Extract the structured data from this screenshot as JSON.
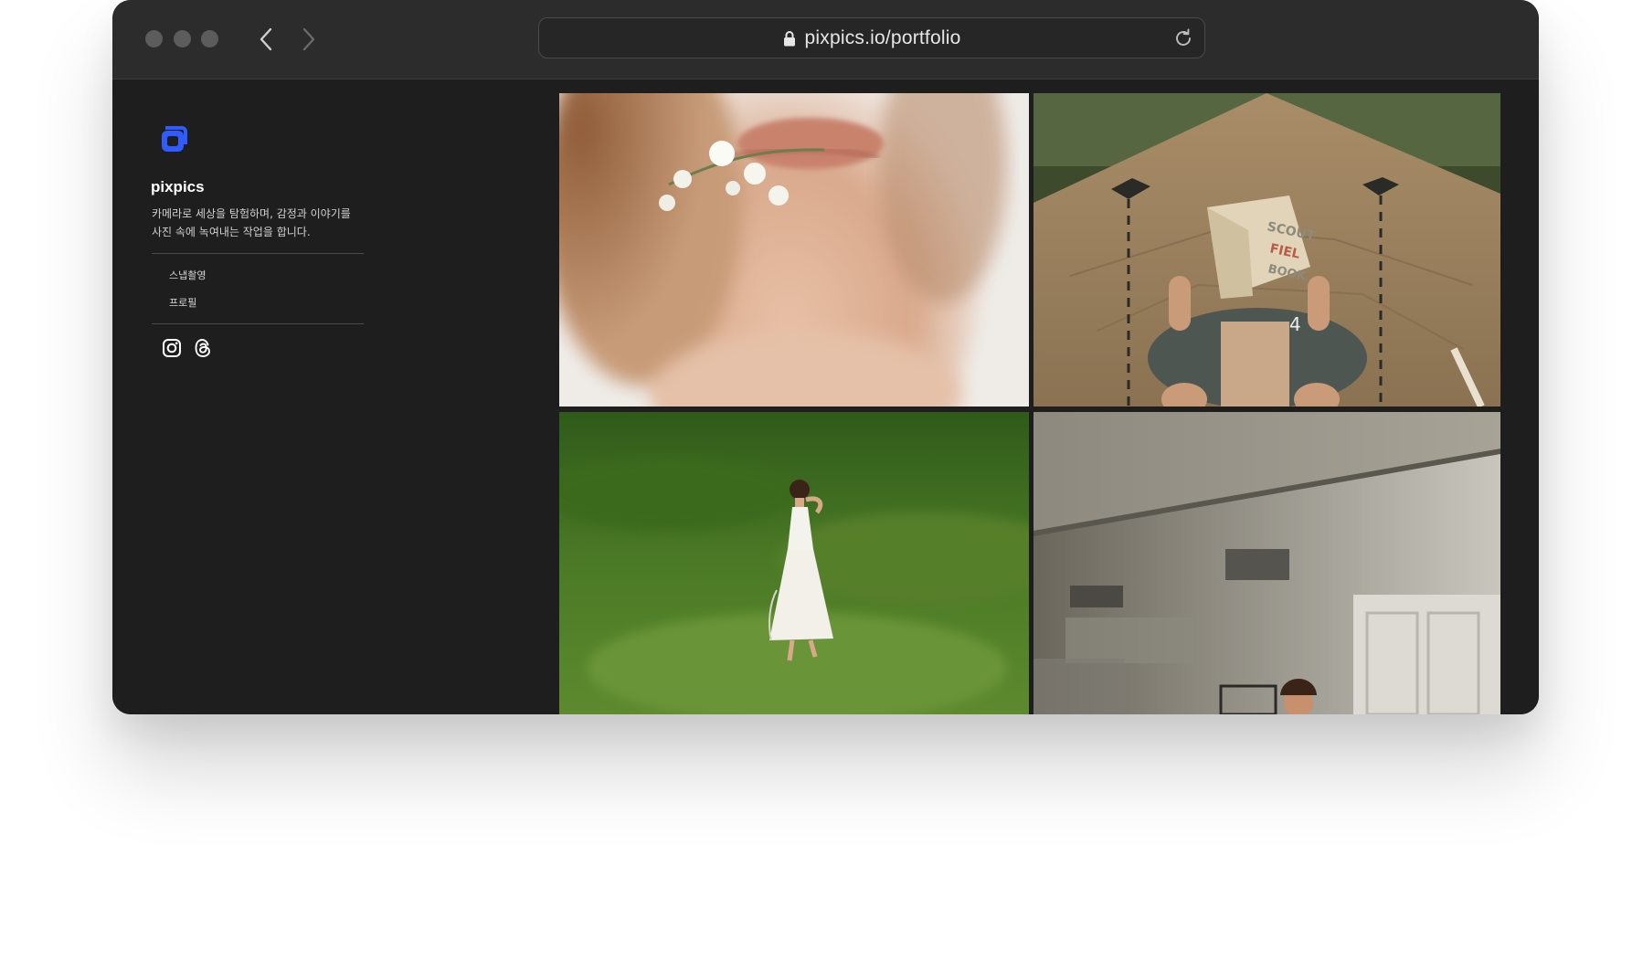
{
  "browser": {
    "url": "pixpics.io/portfolio",
    "icons": {
      "back": "chevron-left-icon",
      "forward": "chevron-right-icon",
      "lock": "lock-icon",
      "reload": "reload-icon"
    }
  },
  "sidebar": {
    "logo_icon": "pixpics-logo",
    "brand_name": "pixpics",
    "description": "카메라로 세상을 탐험하며, 감정과 이야기를 사진 속에 녹여내는 작업을 합니다.",
    "menu": [
      {
        "label": "스냅촬영"
      },
      {
        "label": "프로필"
      }
    ],
    "social": [
      {
        "icon": "instagram-icon"
      },
      {
        "icon": "threads-icon"
      }
    ]
  },
  "gallery": {
    "photos": [
      {
        "subject": "woman-with-white-flowers-closeup"
      },
      {
        "subject": "child-reading-scout-field-book-before-tent"
      },
      {
        "subject": "woman-in-white-dress-on-grass-hill"
      },
      {
        "subject": "woman-in-room-with-white-doors"
      }
    ]
  },
  "colors": {
    "window_bg": "#1e1e1e",
    "toolbar_bg": "#2c2c2c",
    "accent": "#2f5bff",
    "text_primary": "#ffffff"
  }
}
